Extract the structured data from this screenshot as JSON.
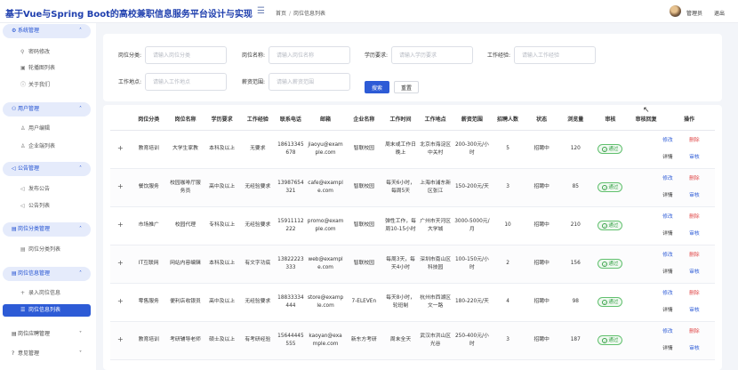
{
  "header": {
    "app_title": "基于Vue与Spring Boot的高校兼职信息服务平台设计与实现",
    "breadcrumb_home": "首页",
    "breadcrumb_current": "岗位信息列表",
    "user_name": "管理员",
    "logout": "退出"
  },
  "sidebar": {
    "groups": [
      {
        "label": "系统管理",
        "items": [
          "密码修改",
          "轮播图列表",
          "关于我们"
        ]
      },
      {
        "label": "用户管理",
        "items": [
          "用户编辑",
          "企业端列表"
        ]
      },
      {
        "label": "公告管理",
        "items": [
          "发布公告",
          "公告列表"
        ]
      },
      {
        "label": "岗位分类管理",
        "items": [
          "岗位分类列表"
        ]
      },
      {
        "label": "岗位信息管理",
        "items": [
          "录入岗位信息",
          "岗位信息列表"
        ]
      },
      {
        "label": "岗位应聘管理",
        "items": []
      },
      {
        "label": "意见管理",
        "items": []
      }
    ]
  },
  "search": {
    "category_label": "岗位分类:",
    "category_placeholder": "请输入岗位分类",
    "name_label": "岗位名称:",
    "name_placeholder": "请输入岗位名称",
    "edu_label": "学历要求:",
    "edu_placeholder": "请输入学历要求",
    "exp_label": "工作经验:",
    "exp_placeholder": "请输入工作经验",
    "location_label": "工作地点:",
    "location_placeholder": "请输入工作地点",
    "salary_label": "薪资范围:",
    "salary_placeholder": "请输入薪资范围",
    "search_button": "搜索",
    "reset_button": "重置"
  },
  "table": {
    "columns": [
      "岗位分类",
      "岗位名称",
      "学历要求",
      "工作经验",
      "联系电话",
      "邮箱",
      "企业名称",
      "工作时间",
      "工作地点",
      "薪资范围",
      "招聘人数",
      "状态",
      "浏览量",
      "审核",
      "审核回复",
      "操作"
    ],
    "rows": [
      {
        "category": "教育培训",
        "name": "大学生家教",
        "edu": "本科及以上",
        "exp": "无要求",
        "phone": "18613345678",
        "email": "jiaoyu@example.com",
        "company": "智联校园",
        "time": "周末或工作日晚上",
        "location": "北京市海淀区中关村",
        "salary": "200-300元/小时",
        "count": "5",
        "status": "招聘中",
        "views": "120",
        "audit": "通过",
        "reply": ""
      },
      {
        "category": "餐饮服务",
        "name": "校园咖啡厅服务员",
        "edu": "高中及以上",
        "exp": "无经验要求",
        "phone": "13987654321",
        "email": "cafe@example.com",
        "company": "智联校园",
        "time": "每天6小时，每周5天",
        "location": "上海市浦东新区张江",
        "salary": "150-200元/天",
        "count": "3",
        "status": "招聘中",
        "views": "85",
        "audit": "通过",
        "reply": ""
      },
      {
        "category": "市场推广",
        "name": "校园代理",
        "edu": "专科及以上",
        "exp": "无经验要求",
        "phone": "15911112222",
        "email": "promo@example.com",
        "company": "智联校园",
        "time": "弹性工作，每周10-15小时",
        "location": "广州市天河区大学城",
        "salary": "3000-5000元/月",
        "count": "10",
        "status": "招聘中",
        "views": "210",
        "audit": "通过",
        "reply": ""
      },
      {
        "category": "IT互联网",
        "name": "网站内容编辑",
        "edu": "本科及以上",
        "exp": "有文字功底",
        "phone": "13822223333",
        "email": "web@example.com",
        "company": "智联校园",
        "time": "每周3天，每天4小时",
        "location": "深圳市南山区科技园",
        "salary": "100-150元/小时",
        "count": "2",
        "status": "招聘中",
        "views": "156",
        "audit": "通过",
        "reply": ""
      },
      {
        "category": "零售服务",
        "name": "便利店收银员",
        "edu": "高中及以上",
        "exp": "无经验要求",
        "phone": "18833334444",
        "email": "store@example.com",
        "company": "7-ELEVEn",
        "time": "每天8小时，轮班制",
        "location": "杭州市西湖区文一路",
        "salary": "180-220元/天",
        "count": "4",
        "status": "招聘中",
        "views": "98",
        "audit": "通过",
        "reply": ""
      },
      {
        "category": "教育培训",
        "name": "考研辅导老师",
        "edu": "硕士及以上",
        "exp": "有考研经验",
        "phone": "15644445555",
        "email": "kaoyan@example.com",
        "company": "新东方考研",
        "time": "周末全天",
        "location": "武汉市洪山区光谷",
        "salary": "250-400元/小时",
        "count": "3",
        "status": "招聘中",
        "views": "187",
        "audit": "通过",
        "reply": ""
      }
    ],
    "actions": {
      "edit": "修改",
      "delete": "删除",
      "detail": "详情",
      "audit": "审核"
    }
  }
}
